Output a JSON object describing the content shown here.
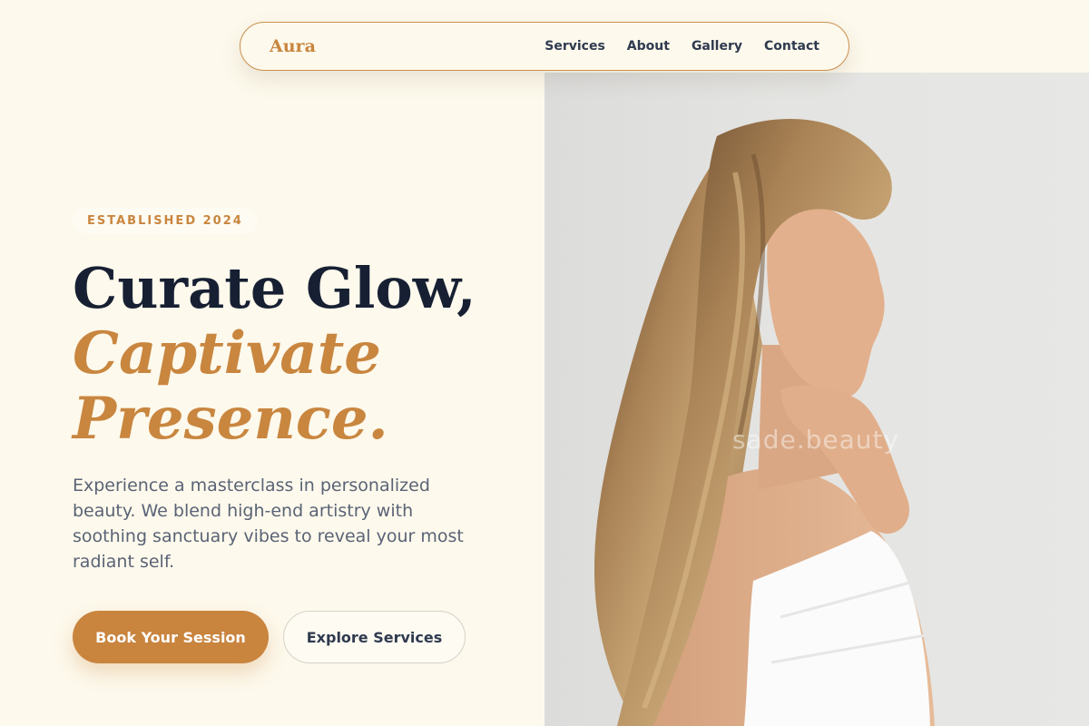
{
  "nav": {
    "logo": "Aura",
    "links": [
      "Services",
      "About",
      "Gallery",
      "Contact"
    ]
  },
  "hero": {
    "badge": "ESTABLISHED 2024",
    "headline_line1": "Curate Glow,",
    "headline_line2": "Captivate",
    "headline_line3": "Presence.",
    "description": "Experience a masterclass in personalized beauty. We blend high-end artistry with soothing sanctuary vibes to reveal your most radiant self.",
    "primary_button": "Book Your Session",
    "secondary_button": "Explore Services"
  },
  "image": {
    "watermark": "sade.beauty"
  },
  "colors": {
    "background": "#fdf9ec",
    "accent": "#c9863f",
    "heading": "#172033",
    "body_text": "#5a6376"
  }
}
